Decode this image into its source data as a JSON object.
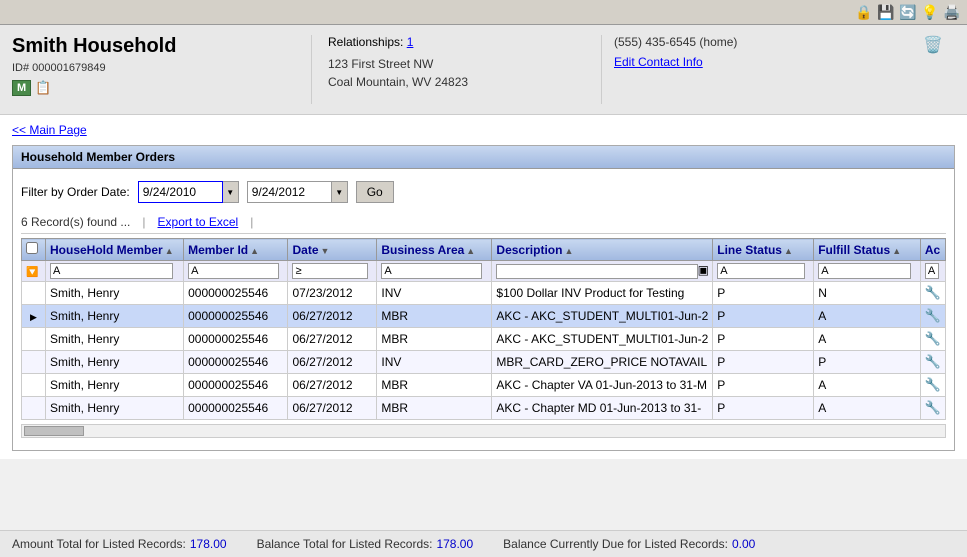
{
  "toolbar": {
    "icons": [
      "🔒",
      "💾",
      "🔄",
      "💡",
      "🖨️"
    ]
  },
  "header": {
    "title": "Smith Household",
    "id_label": "ID# 000001679849",
    "badge_m": "M",
    "relationships_label": "Relationships:",
    "relationships_count": "1",
    "address_line1": "123 First Street NW",
    "address_line2": "Coal Mountain, WV 24823",
    "phone": "(555) 435-6545 (home)",
    "edit_contact_label": "Edit Contact Info"
  },
  "navigation": {
    "main_page_link": "<< Main Page"
  },
  "panel": {
    "title": "Household Member Orders",
    "filter_label": "Filter by Order Date:",
    "date_from": "9/24/2010",
    "date_to": "9/24/2012",
    "go_label": "Go",
    "records_found": "6 Record(s) found ...",
    "export_label": "Export to Excel"
  },
  "table": {
    "columns": [
      {
        "key": "member",
        "label": "HouseHold Member"
      },
      {
        "key": "member_id",
        "label": "Member Id"
      },
      {
        "key": "date",
        "label": "Date"
      },
      {
        "key": "business_area",
        "label": "Business Area"
      },
      {
        "key": "description",
        "label": "Description"
      },
      {
        "key": "line_status",
        "label": "Line Status"
      },
      {
        "key": "fulfill_status",
        "label": "Fulfill Status"
      },
      {
        "key": "action",
        "label": "Ac"
      }
    ],
    "rows": [
      {
        "member": "Smith, Henry",
        "member_id": "000000025546",
        "date": "07/23/2012",
        "business_area": "INV",
        "description": "$100 Dollar INV Product for Testing",
        "line_status": "P",
        "fulfill_status": "N",
        "selected": false
      },
      {
        "member": "Smith, Henry",
        "member_id": "000000025546",
        "date": "06/27/2012",
        "business_area": "MBR",
        "description": "AKC - AKC_STUDENT_MULTI01-Jun-2",
        "line_status": "P",
        "fulfill_status": "A",
        "selected": true
      },
      {
        "member": "Smith, Henry",
        "member_id": "000000025546",
        "date": "06/27/2012",
        "business_area": "MBR",
        "description": "AKC - AKC_STUDENT_MULTI01-Jun-2",
        "line_status": "P",
        "fulfill_status": "A",
        "selected": false
      },
      {
        "member": "Smith, Henry",
        "member_id": "000000025546",
        "date": "06/27/2012",
        "business_area": "INV",
        "description": "MBR_CARD_ZERO_PRICE NOTAVAIL",
        "line_status": "P",
        "fulfill_status": "P",
        "selected": false
      },
      {
        "member": "Smith, Henry",
        "member_id": "000000025546",
        "date": "06/27/2012",
        "business_area": "MBR",
        "description": "AKC - Chapter VA 01-Jun-2013 to 31-M",
        "line_status": "P",
        "fulfill_status": "A",
        "selected": false
      },
      {
        "member": "Smith, Henry",
        "member_id": "000000025546",
        "date": "06/27/2012",
        "business_area": "MBR",
        "description": "AKC - Chapter MD 01-Jun-2013 to 31-",
        "line_status": "P",
        "fulfill_status": "A",
        "selected": false
      }
    ]
  },
  "footer": {
    "amount_label": "Amount Total for Listed Records:",
    "amount_value": "178.00",
    "balance_label": "Balance Total for Listed Records:",
    "balance_value": "178.00",
    "balance_due_label": "Balance Currently Due for Listed Records:",
    "balance_due_value": "0.00"
  }
}
